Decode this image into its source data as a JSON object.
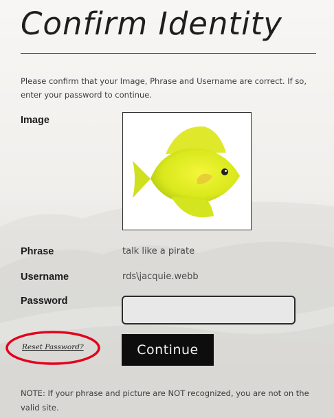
{
  "page": {
    "title": "Confirm Identity",
    "intro": "Please confirm that your Image, Phrase and Username are correct. If so, enter your password to continue."
  },
  "form": {
    "image_label": "Image",
    "phrase_label": "Phrase",
    "phrase_value": "talk like a pirate",
    "username_label": "Username",
    "username_value": "rds\\jacquie.webb",
    "password_label": "Password",
    "password_value": "",
    "reset_link": "Reset Password?",
    "continue_label": "Continue"
  },
  "note": "NOTE: If your phrase and picture are NOT recognized, you are not on the valid site.",
  "colors": {
    "highlight": "#e3001b",
    "button_bg": "#0d0d0d",
    "fish": "#e8ef1f"
  },
  "icons": {
    "security_image": "yellow-tang-fish-image"
  }
}
